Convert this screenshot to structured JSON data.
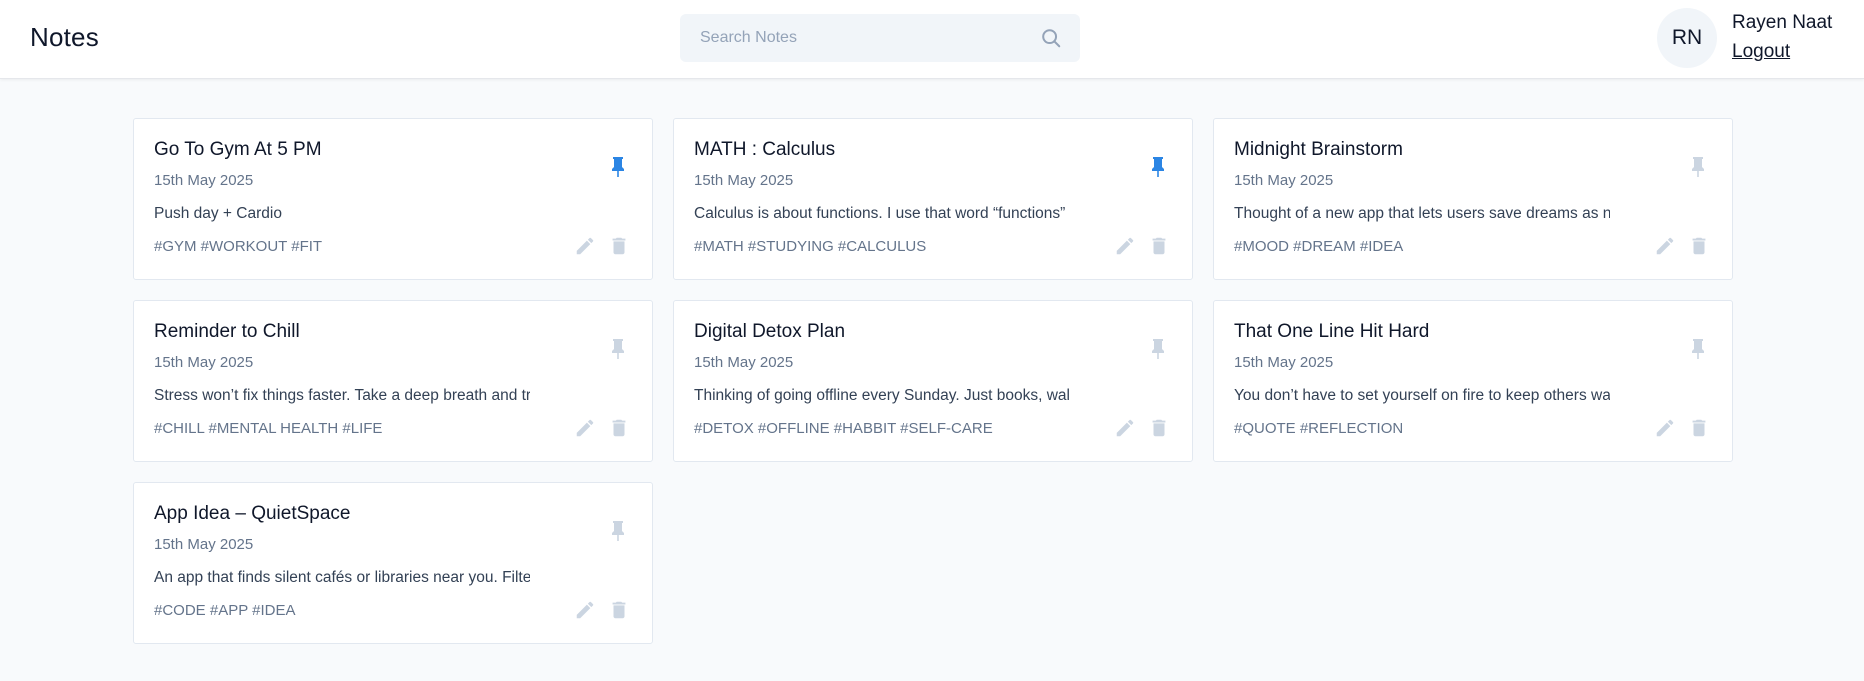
{
  "header": {
    "title": "Notes",
    "search_placeholder": "Search Notes",
    "user_initials": "RN",
    "user_name": "Rayen Naat",
    "logout_label": "Logout"
  },
  "colors": {
    "pinned": "#2b85e4",
    "unpinned": "#cbd5e1",
    "action": "#cbd5e1"
  },
  "notes": [
    {
      "title": "Go To Gym At 5 PM",
      "date": "15th May 2025",
      "content": "Push day + Cardio",
      "tags": "#GYM #WORKOUT #FIT",
      "pinned": true
    },
    {
      "title": "MATH : Calculus",
      "date": "15th May 2025",
      "content": "Calculus is about functions. I use that word “functions” in",
      "tags": "#MATH #STUDYING #CALCULUS",
      "pinned": true
    },
    {
      "title": "Midnight Brainstorm",
      "date": "15th May 2025",
      "content": "Thought of a new app that lets users save dreams as notes wi",
      "tags": "#MOOD #DREAM #IDEA",
      "pinned": false
    },
    {
      "title": "Reminder to Chill",
      "date": "15th May 2025",
      "content": "Stress won’t fix things faster. Take a deep breath and trust",
      "tags": "#CHILL #MENTAL HEALTH #LIFE",
      "pinned": false
    },
    {
      "title": "Digital Detox Plan",
      "date": "15th May 2025",
      "content": "Thinking of going offline every Sunday. Just books, walks, a",
      "tags": "#DETOX #OFFLINE #HABBIT #SELF-CARE",
      "pinned": false
    },
    {
      "title": "That One Line Hit Hard",
      "date": "15th May 2025",
      "content": "You don’t have to set yourself on fire to keep others warm.”",
      "tags": "#QUOTE #REFLECTION",
      "pinned": false
    },
    {
      "title": "App Idea – QuietSpace",
      "date": "15th May 2025",
      "content": "An app that finds silent cafés or libraries near you. Filter",
      "tags": "#CODE #APP #IDEA",
      "pinned": false
    }
  ]
}
